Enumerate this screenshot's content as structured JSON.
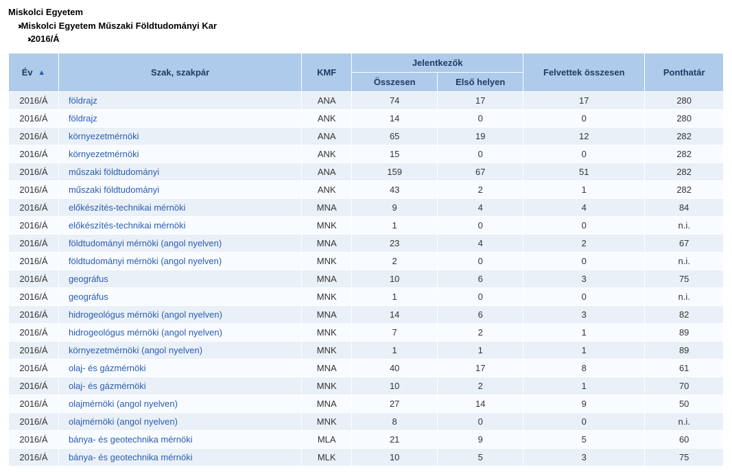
{
  "breadcrumb": {
    "l1": "Miskolci Egyetem",
    "l2": "Miskolci Egyetem Műszaki Földtudományi Kar",
    "l3": "2016/Á"
  },
  "headers": {
    "ev": "Év",
    "szak": "Szak, szakpár",
    "kmf": "KMF",
    "jelentkezok": "Jelentkezők",
    "osszesen": "Összesen",
    "elso_helyen": "Első helyen",
    "felvettek": "Felvettek összesen",
    "ponthatar": "Ponthatár",
    "sort_indicator": "▲"
  },
  "rows": [
    {
      "ev": "2016/Á",
      "szak": "földrajz",
      "kmf": "ANA",
      "ossz": "74",
      "elso": "17",
      "felv": "17",
      "pont": "280"
    },
    {
      "ev": "2016/Á",
      "szak": "földrajz",
      "kmf": "ANK",
      "ossz": "14",
      "elso": "0",
      "felv": "0",
      "pont": "280"
    },
    {
      "ev": "2016/Á",
      "szak": "környezetmérnöki",
      "kmf": "ANA",
      "ossz": "65",
      "elso": "19",
      "felv": "12",
      "pont": "282"
    },
    {
      "ev": "2016/Á",
      "szak": "környezetmérnöki",
      "kmf": "ANK",
      "ossz": "15",
      "elso": "0",
      "felv": "0",
      "pont": "282"
    },
    {
      "ev": "2016/Á",
      "szak": "műszaki földtudományi",
      "kmf": "ANA",
      "ossz": "159",
      "elso": "67",
      "felv": "51",
      "pont": "282"
    },
    {
      "ev": "2016/Á",
      "szak": "műszaki földtudományi",
      "kmf": "ANK",
      "ossz": "43",
      "elso": "2",
      "felv": "1",
      "pont": "282"
    },
    {
      "ev": "2016/Á",
      "szak": "előkészítés-technikai mérnöki",
      "kmf": "MNA",
      "ossz": "9",
      "elso": "4",
      "felv": "4",
      "pont": "84"
    },
    {
      "ev": "2016/Á",
      "szak": "előkészítés-technikai mérnöki",
      "kmf": "MNK",
      "ossz": "1",
      "elso": "0",
      "felv": "0",
      "pont": "n.i."
    },
    {
      "ev": "2016/Á",
      "szak": "földtudományi mérnöki (angol nyelven)",
      "kmf": "MNA",
      "ossz": "23",
      "elso": "4",
      "felv": "2",
      "pont": "67"
    },
    {
      "ev": "2016/Á",
      "szak": "földtudományi mérnöki (angol nyelven)",
      "kmf": "MNK",
      "ossz": "2",
      "elso": "0",
      "felv": "0",
      "pont": "n.i."
    },
    {
      "ev": "2016/Á",
      "szak": "geográfus",
      "kmf": "MNA",
      "ossz": "10",
      "elso": "6",
      "felv": "3",
      "pont": "75"
    },
    {
      "ev": "2016/Á",
      "szak": "geográfus",
      "kmf": "MNK",
      "ossz": "1",
      "elso": "0",
      "felv": "0",
      "pont": "n.i."
    },
    {
      "ev": "2016/Á",
      "szak": "hidrogeológus mérnöki (angol nyelven)",
      "kmf": "MNA",
      "ossz": "14",
      "elso": "6",
      "felv": "3",
      "pont": "82"
    },
    {
      "ev": "2016/Á",
      "szak": "hidrogeológus mérnöki (angol nyelven)",
      "kmf": "MNK",
      "ossz": "7",
      "elso": "2",
      "felv": "1",
      "pont": "89"
    },
    {
      "ev": "2016/Á",
      "szak": "környezetmérnöki (angol nyelven)",
      "kmf": "MNK",
      "ossz": "1",
      "elso": "1",
      "felv": "1",
      "pont": "89"
    },
    {
      "ev": "2016/Á",
      "szak": "olaj- és gázmérnöki",
      "kmf": "MNA",
      "ossz": "40",
      "elso": "17",
      "felv": "8",
      "pont": "61"
    },
    {
      "ev": "2016/Á",
      "szak": "olaj- és gázmérnöki",
      "kmf": "MNK",
      "ossz": "10",
      "elso": "2",
      "felv": "1",
      "pont": "70"
    },
    {
      "ev": "2016/Á",
      "szak": "olajmérnöki (angol nyelven)",
      "kmf": "MNA",
      "ossz": "27",
      "elso": "14",
      "felv": "9",
      "pont": "50"
    },
    {
      "ev": "2016/Á",
      "szak": "olajmérnöki (angol nyelven)",
      "kmf": "MNK",
      "ossz": "8",
      "elso": "0",
      "felv": "0",
      "pont": "n.i."
    },
    {
      "ev": "2016/Á",
      "szak": "bánya- és geotechnika mérnöki",
      "kmf": "MLA",
      "ossz": "21",
      "elso": "9",
      "felv": "5",
      "pont": "60"
    },
    {
      "ev": "2016/Á",
      "szak": "bánya- és geotechnika mérnöki",
      "kmf": "MLK",
      "ossz": "10",
      "elso": "5",
      "felv": "3",
      "pont": "75"
    }
  ]
}
